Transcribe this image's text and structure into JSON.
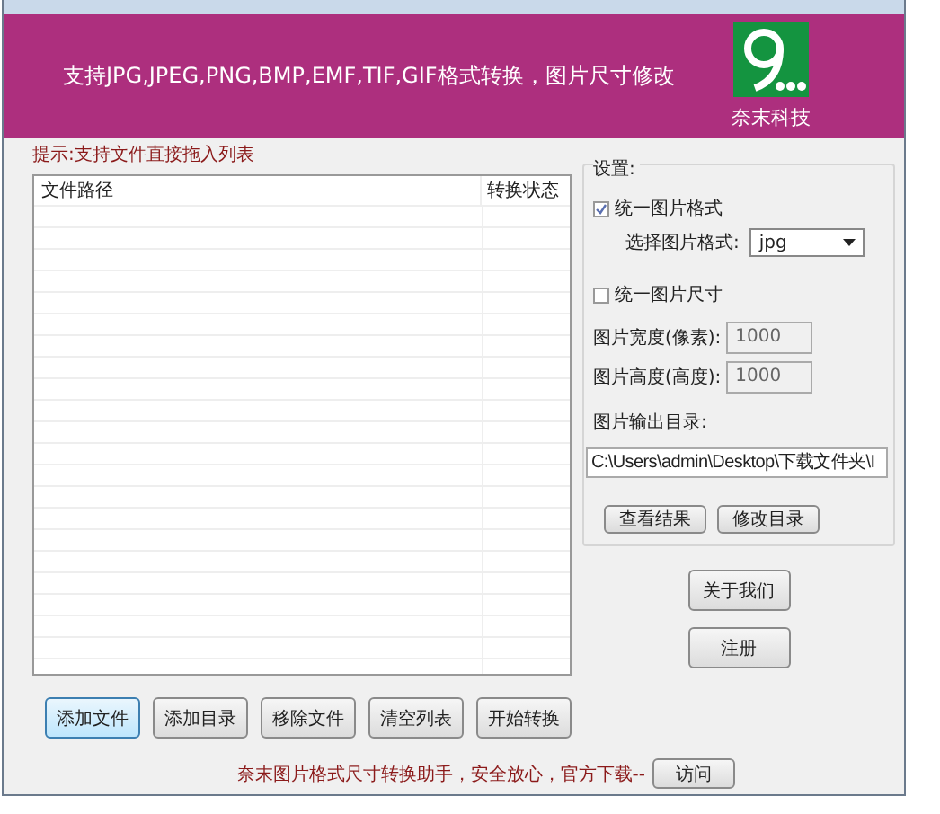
{
  "banner": {
    "text": "支持JPG,JPEG,PNG,BMP,EMF,TIF,GIF格式转换，图片尺寸修改",
    "brand": "奈末科技"
  },
  "hint": "提示:支持文件直接拖入列表",
  "file_list": {
    "columns": [
      "文件路径",
      "转换状态"
    ]
  },
  "settings": {
    "title": "设置:",
    "unify_format": {
      "label": "统一图片格式",
      "checked": true
    },
    "format": {
      "label": "选择图片格式:",
      "value": "jpg"
    },
    "unify_size": {
      "label": "统一图片尺寸",
      "checked": false
    },
    "width": {
      "label": "图片宽度(像素):",
      "value": "1000",
      "disabled": true
    },
    "height": {
      "label": "图片高度(高度):",
      "value": "1000",
      "disabled": true
    },
    "output": {
      "label": "图片输出目录:",
      "value": "C:\\Users\\admin\\Desktop\\下载文件夹\\I"
    },
    "buttons": [
      "查看结果",
      "修改目录"
    ]
  },
  "side_buttons": [
    "关于我们",
    "注册"
  ],
  "bottom_buttons": [
    {
      "label": "添加文件",
      "selected": true
    },
    {
      "label": "添加目录",
      "selected": false
    },
    {
      "label": "移除文件",
      "selected": false
    },
    {
      "label": "清空列表",
      "selected": false
    },
    {
      "label": "开始转换",
      "selected": false
    }
  ],
  "footer": {
    "text": "奈末图片格式尺寸转换助手，安全放心，官方下载--",
    "button": "访问"
  }
}
